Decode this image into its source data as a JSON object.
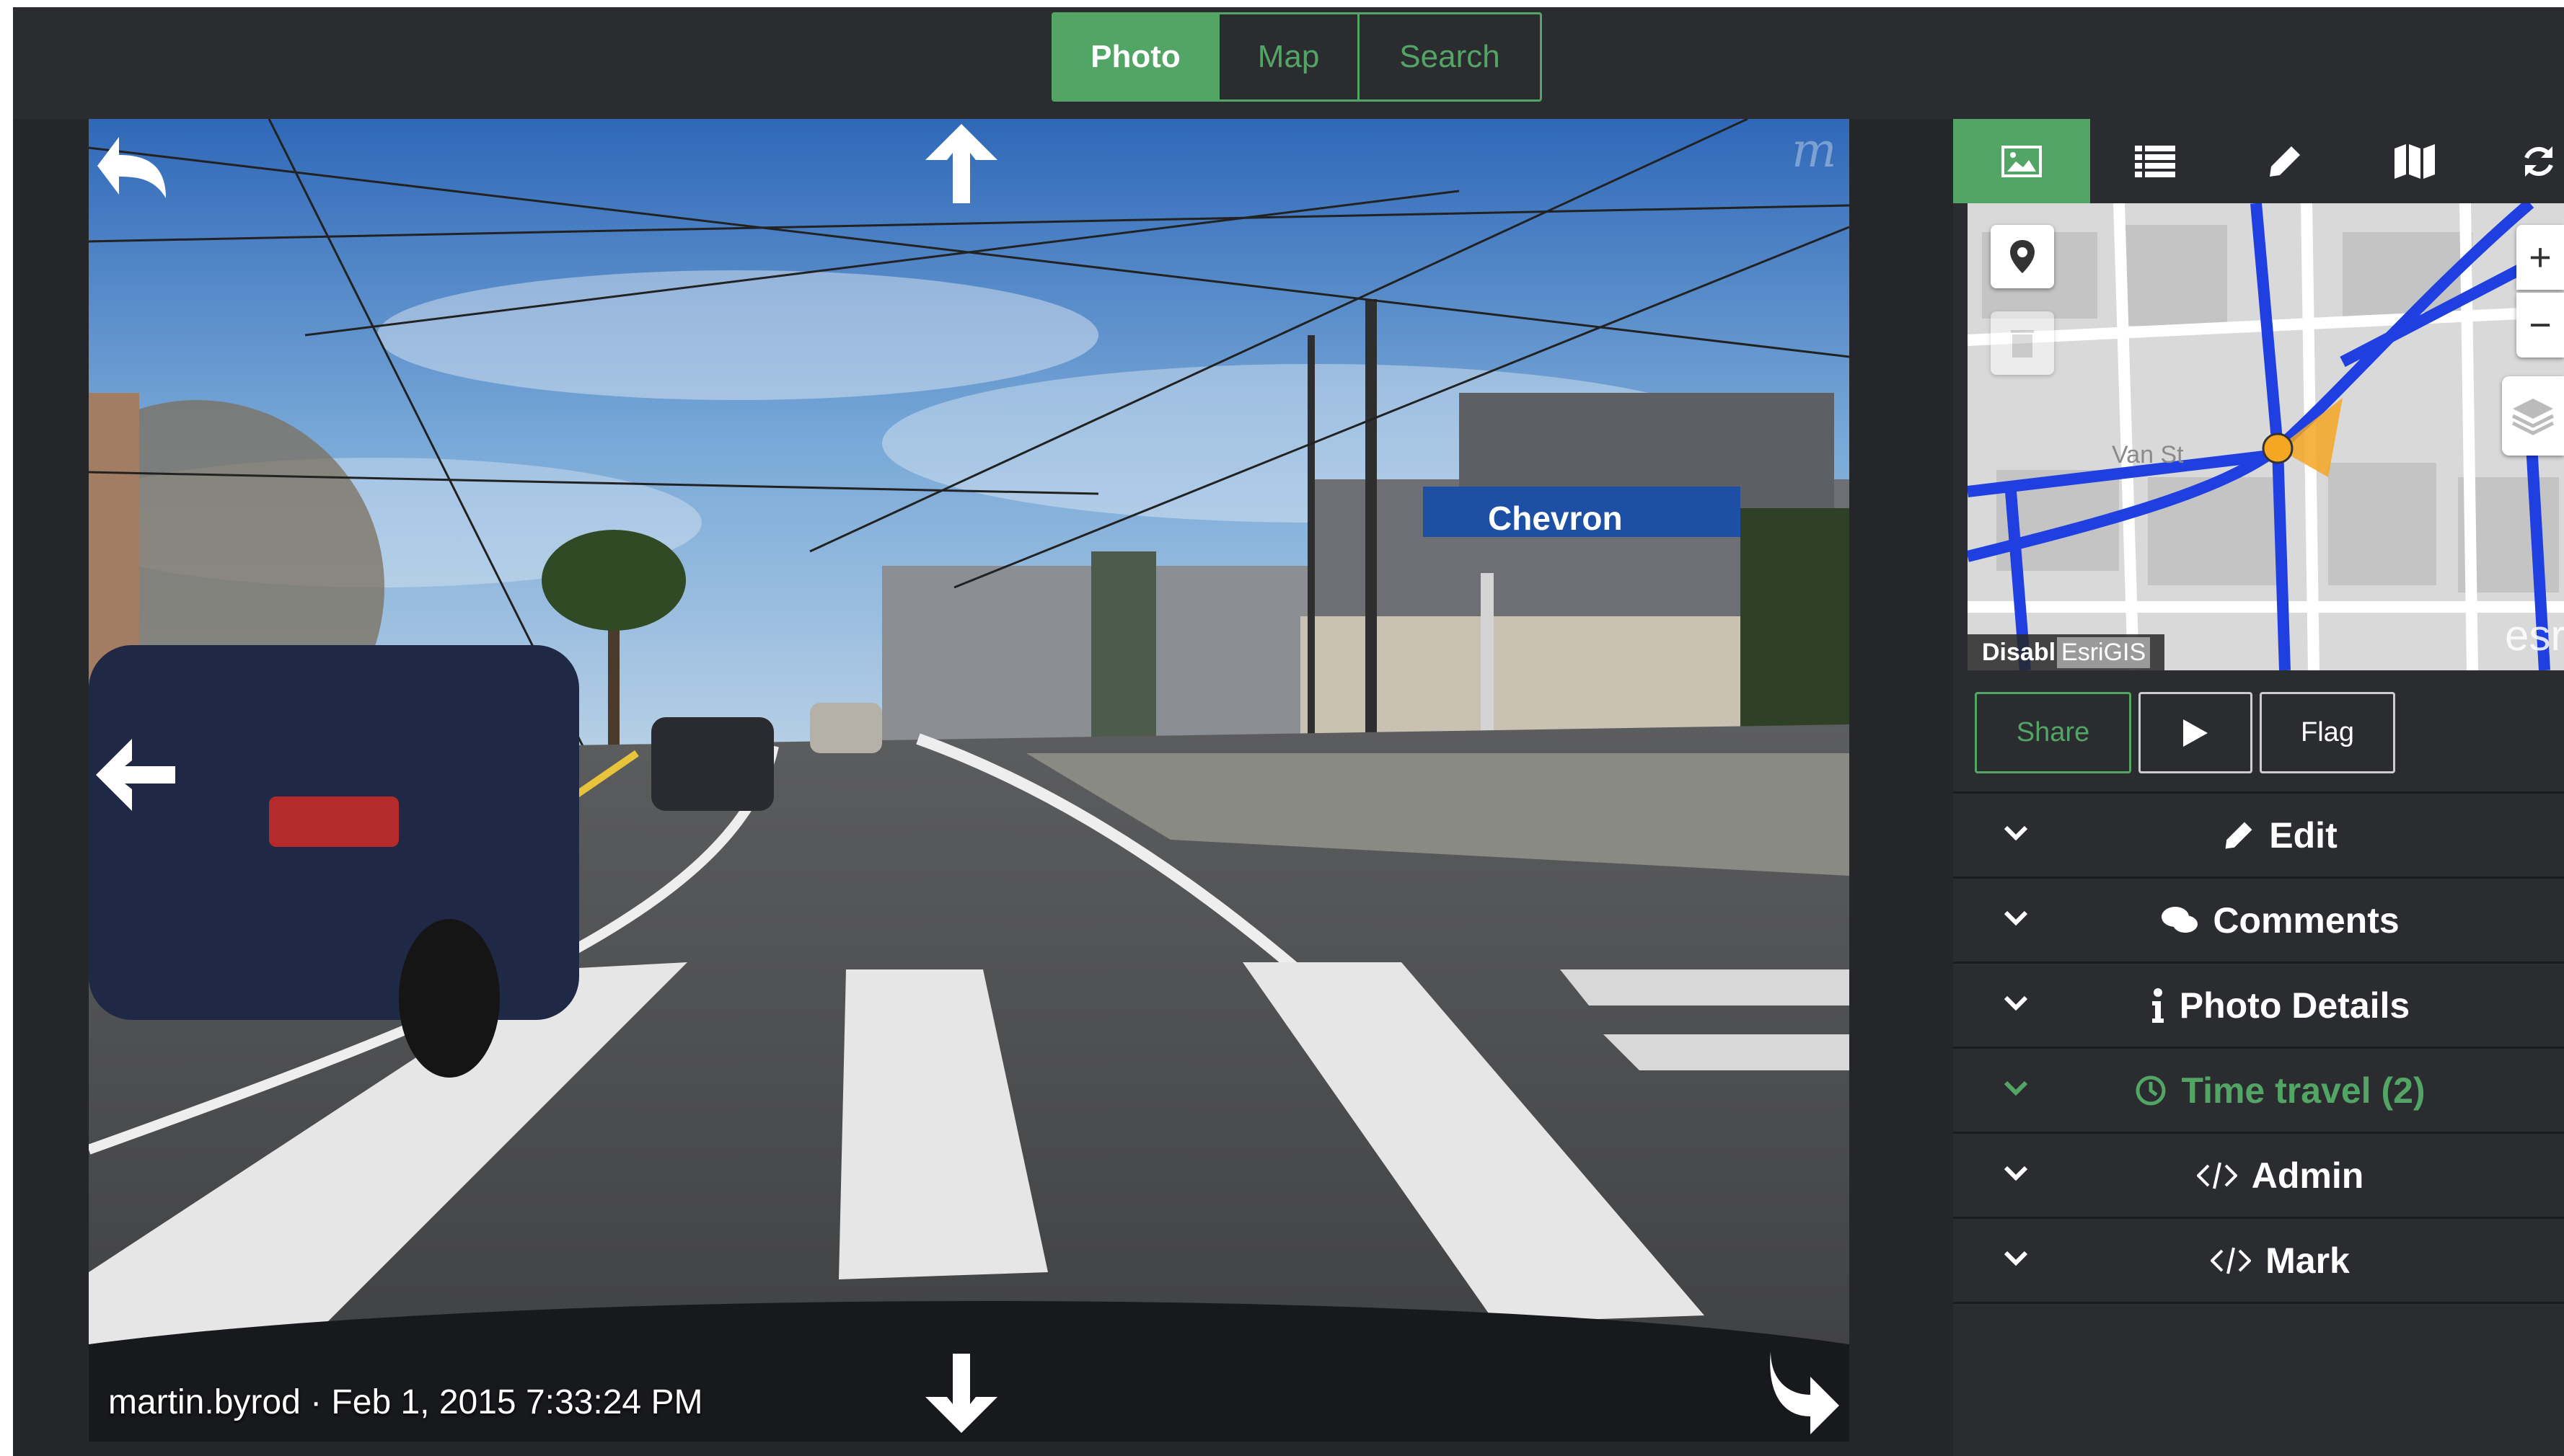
{
  "header": {
    "tabs": [
      {
        "label": "Photo",
        "active": true
      },
      {
        "label": "Map",
        "active": false
      },
      {
        "label": "Search",
        "active": false
      }
    ]
  },
  "viewer": {
    "credit": "martin.byrod · Feb 1, 2015 7:33:24 PM",
    "sign_text": "Chevron",
    "watermark": "m",
    "nav_icons": [
      "undo-arrow-icon",
      "arrow-up-icon",
      "arrow-left-icon",
      "arrow-down-icon",
      "redo-arrow-icon"
    ]
  },
  "panel": {
    "tab_icons": [
      "image-icon",
      "list-icon",
      "pencil-icon",
      "map-icon",
      "refresh-icon"
    ],
    "minimap": {
      "attribution": "Disabl",
      "esri_label": "EsriGIS",
      "esri_short": "Esri",
      "logo": "esri",
      "street_label": "Van St"
    },
    "actions": {
      "share": "Share",
      "flag": "Flag"
    },
    "sections": [
      {
        "label": "Edit",
        "icon": "pencil-icon",
        "highlight": false
      },
      {
        "label": "Comments",
        "icon": "comments-icon",
        "highlight": false
      },
      {
        "label": "Photo Details",
        "icon": "info-icon",
        "highlight": false
      },
      {
        "label": "Time travel (2)",
        "icon": "clock-icon",
        "highlight": true
      },
      {
        "label": "Admin",
        "icon": "code-icon",
        "highlight": false
      },
      {
        "label": "Mark",
        "icon": "code-icon",
        "highlight": false
      }
    ]
  },
  "colors": {
    "accent": "#53a565",
    "background": "#2b2c2f",
    "route": "#1f3fe0",
    "marker": "#f5a623"
  }
}
